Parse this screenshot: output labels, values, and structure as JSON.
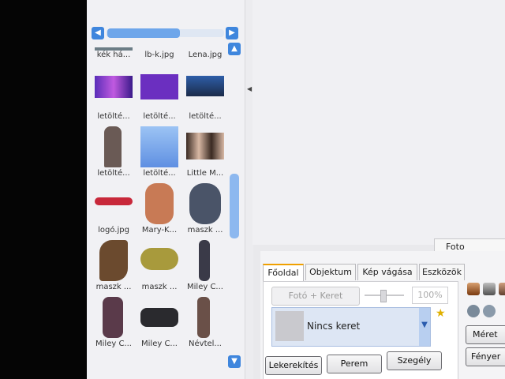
{
  "thumbnail_panel": {
    "top_row": [
      "kék há...",
      "lb-k.jpg",
      "Lena.jpg"
    ],
    "rows": [
      [
        "letölté...",
        "letölté...",
        "letölté..."
      ],
      [
        "letölté...",
        "letölté...",
        "Little M..."
      ],
      [
        "logó.jpg",
        "Mary-K...",
        "maszk ..."
      ],
      [
        "maszk ...",
        "maszk ...",
        "Miley C..."
      ],
      [
        "Miley C...",
        "Miley C...",
        "Névtel..."
      ]
    ]
  },
  "mini_tab": {
    "label": "Foto"
  },
  "tabs": [
    {
      "label": "Főoldal",
      "active": true
    },
    {
      "label": "Objektum",
      "active": false
    },
    {
      "label": "Kép vágása",
      "active": false
    },
    {
      "label": "Eszközök",
      "active": false
    }
  ],
  "home_tab": {
    "photo_frame_button": "Fotó + Keret",
    "zoom_value": "100%",
    "frame_select_value": "Nincs keret",
    "buttons": {
      "rounding": "Lekerekítés",
      "margin": "Perem",
      "border": "Szegély"
    }
  },
  "right_tools": {
    "resize_button": "Méret",
    "brightness_button": "Fényer"
  },
  "colors": {
    "accent_blue": "#3f86dd",
    "tab_orange": "#f0a000"
  }
}
